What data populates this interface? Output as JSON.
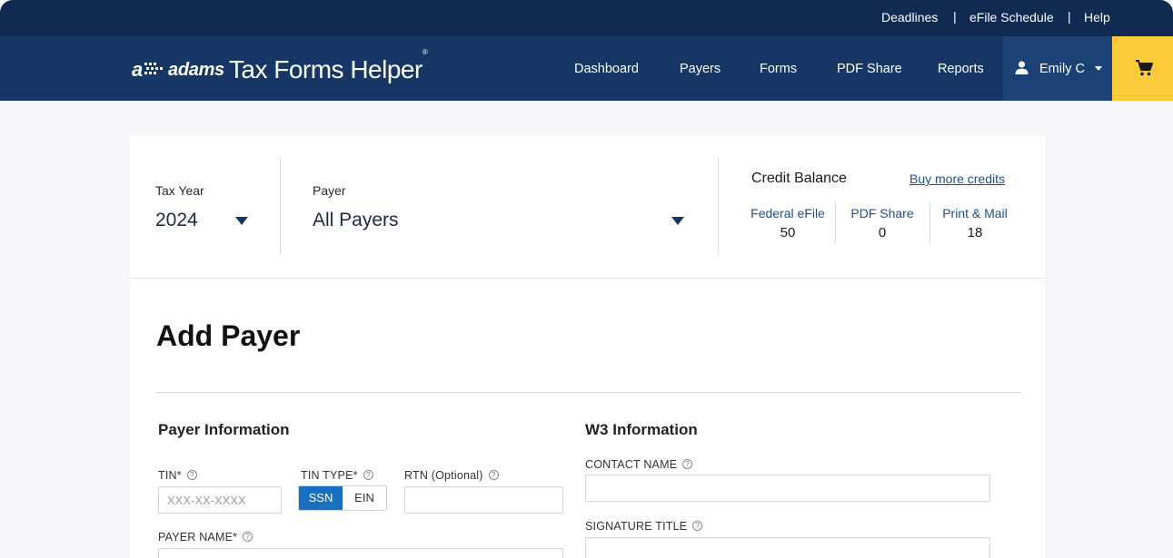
{
  "utility_links": {
    "deadlines": "Deadlines",
    "separator": "|",
    "efile_schedule": "eFile Schedule",
    "help": "Help"
  },
  "brand": {
    "adams": "adams",
    "product": "Tax Forms Helper",
    "registered": "®"
  },
  "nav": {
    "dashboard": "Dashboard",
    "payers": "Payers",
    "forms": "Forms",
    "pdf_share": "PDF Share",
    "reports": "Reports",
    "user": "Emily C"
  },
  "filters": {
    "tax_year_label": "Tax Year",
    "tax_year_value": "2024",
    "payer_label": "Payer",
    "payer_value": "All Payers"
  },
  "credits": {
    "title": "Credit Balance",
    "buy_link": "Buy more credits",
    "items": [
      {
        "label": "Federal eFile",
        "value": "50"
      },
      {
        "label": "PDF Share",
        "value": "0"
      },
      {
        "label": "Print & Mail",
        "value": "18"
      }
    ]
  },
  "page": {
    "title": "Add Payer"
  },
  "payer_info": {
    "title": "Payer Information",
    "tin_label": "TIN*",
    "tin_placeholder": "XXX-XX-XXXX",
    "tin_type_label": "TIN TYPE*",
    "tin_type_options": [
      "SSN",
      "EIN"
    ],
    "tin_type_selected": "SSN",
    "rtn_label": "RTN (Optional)",
    "payer_name_label": "PAYER NAME*"
  },
  "w3_info": {
    "title": "W3 Information",
    "contact_name_label": "CONTACT NAME",
    "signature_title_label": "SIGNATURE TITLE"
  },
  "help_glyph": "?",
  "colors": {
    "utility_bar": "#102a52",
    "nav_bar": "#163766",
    "cart_accent": "#fbcb3b",
    "link": "#1b4f8f",
    "toggle_active": "#1771c0"
  }
}
